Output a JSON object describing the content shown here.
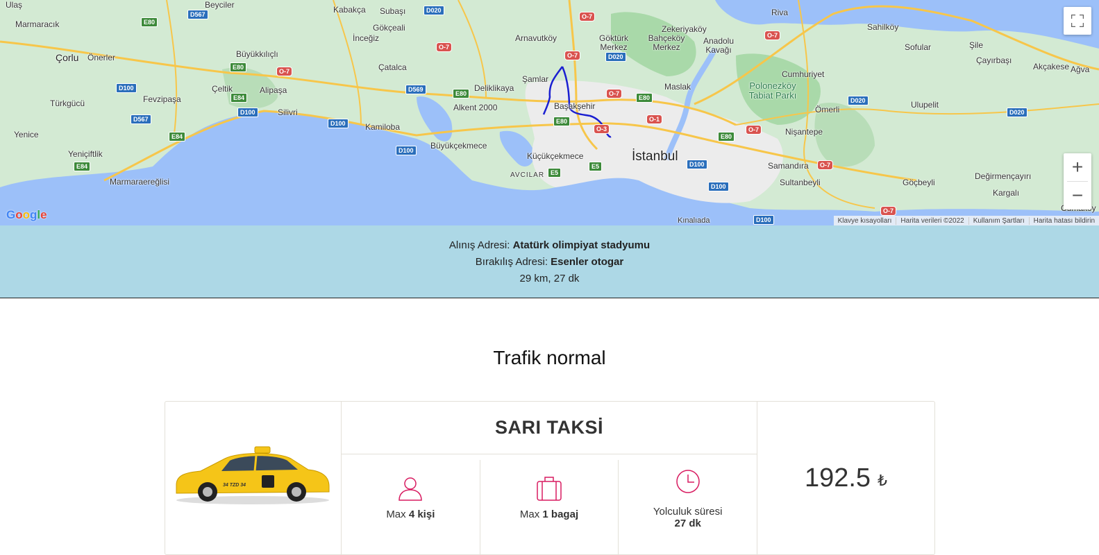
{
  "map": {
    "places": [
      {
        "name": "Ulaş",
        "cls": ""
      },
      {
        "name": "Beyciler",
        "cls": ""
      },
      {
        "name": "Kabakça",
        "cls": ""
      },
      {
        "name": "Subaşı",
        "cls": ""
      },
      {
        "name": "Marmaracık",
        "cls": ""
      },
      {
        "name": "Gökçeali",
        "cls": ""
      },
      {
        "name": "İnceğiz",
        "cls": ""
      },
      {
        "name": "Çorlu",
        "cls": "med"
      },
      {
        "name": "Önerler",
        "cls": ""
      },
      {
        "name": "Büyükkılıçlı",
        "cls": ""
      },
      {
        "name": "Arnavutköy",
        "cls": ""
      },
      {
        "name": "Göktürk Merkez",
        "cls": ""
      },
      {
        "name": "Zekeriyaköy",
        "cls": ""
      },
      {
        "name": "Bahçeköy Merkez",
        "cls": ""
      },
      {
        "name": "Anadolu Kavağı",
        "cls": ""
      },
      {
        "name": "Riva",
        "cls": ""
      },
      {
        "name": "Sahilköy",
        "cls": ""
      },
      {
        "name": "Sofular",
        "cls": ""
      },
      {
        "name": "Şile",
        "cls": ""
      },
      {
        "name": "Çayırbaşı",
        "cls": ""
      },
      {
        "name": "Akçakese",
        "cls": ""
      },
      {
        "name": "Ağva",
        "cls": ""
      },
      {
        "name": "Çatalca",
        "cls": ""
      },
      {
        "name": "Şamlar",
        "cls": ""
      },
      {
        "name": "Alipaşa",
        "cls": ""
      },
      {
        "name": "Çeltik",
        "cls": ""
      },
      {
        "name": "Deliklikaya",
        "cls": ""
      },
      {
        "name": "Maslak",
        "cls": ""
      },
      {
        "name": "Cumhuriyet",
        "cls": ""
      },
      {
        "name": "Polonezköy Tabiat Parkı",
        "cls": "park"
      },
      {
        "name": "Türkgücü",
        "cls": ""
      },
      {
        "name": "Fevzipaşa",
        "cls": ""
      },
      {
        "name": "Silivri",
        "cls": ""
      },
      {
        "name": "Alkent 2000",
        "cls": ""
      },
      {
        "name": "Başakşehir",
        "cls": ""
      },
      {
        "name": "Ömerli",
        "cls": ""
      },
      {
        "name": "Ulupelit",
        "cls": ""
      },
      {
        "name": "Yenice",
        "cls": ""
      },
      {
        "name": "Kamiloba",
        "cls": ""
      },
      {
        "name": "Nişantepe",
        "cls": ""
      },
      {
        "name": "Büyükçekmece",
        "cls": ""
      },
      {
        "name": "Yeniçiftlik",
        "cls": ""
      },
      {
        "name": "Küçükçekmece",
        "cls": ""
      },
      {
        "name": "İstanbul",
        "cls": "big"
      },
      {
        "name": "Samandıra",
        "cls": ""
      },
      {
        "name": "AVCILAR",
        "cls": ""
      },
      {
        "name": "Sultanbeyli",
        "cls": ""
      },
      {
        "name": "Göçbeyli",
        "cls": ""
      },
      {
        "name": "Değirmençayırı",
        "cls": ""
      },
      {
        "name": "Marmaraereğlisi",
        "cls": ""
      },
      {
        "name": "Kargalı",
        "cls": ""
      },
      {
        "name": "Kınalıada",
        "cls": ""
      },
      {
        "name": "Cumaköy",
        "cls": ""
      }
    ],
    "shields": [
      {
        "t": "D567",
        "c": "blue"
      },
      {
        "t": "D020",
        "c": "blue"
      },
      {
        "t": "E80",
        "c": "green"
      },
      {
        "t": "O-7",
        "c": "red"
      },
      {
        "t": "O-7",
        "c": "red"
      },
      {
        "t": "D020",
        "c": "blue"
      },
      {
        "t": "O-7",
        "c": "red"
      },
      {
        "t": "E80",
        "c": "green"
      },
      {
        "t": "O-7",
        "c": "red"
      },
      {
        "t": "D100",
        "c": "blue"
      },
      {
        "t": "D569",
        "c": "blue"
      },
      {
        "t": "E80",
        "c": "green"
      },
      {
        "t": "O-7",
        "c": "red"
      },
      {
        "t": "E84",
        "c": "green"
      },
      {
        "t": "E80",
        "c": "green"
      },
      {
        "t": "D100",
        "c": "blue"
      },
      {
        "t": "D567",
        "c": "blue"
      },
      {
        "t": "O-1",
        "c": "red"
      },
      {
        "t": "E80",
        "c": "green"
      },
      {
        "t": "O-3",
        "c": "red"
      },
      {
        "t": "D100",
        "c": "blue"
      },
      {
        "t": "D020",
        "c": "blue"
      },
      {
        "t": "O-7",
        "c": "red"
      },
      {
        "t": "E84",
        "c": "green"
      },
      {
        "t": "E80",
        "c": "green"
      },
      {
        "t": "O-7",
        "c": "red"
      },
      {
        "t": "D100",
        "c": "blue"
      },
      {
        "t": "D020",
        "c": "blue"
      },
      {
        "t": "E84",
        "c": "green"
      },
      {
        "t": "E5",
        "c": "green"
      },
      {
        "t": "E5",
        "c": "green"
      },
      {
        "t": "D100",
        "c": "blue"
      },
      {
        "t": "O-7",
        "c": "red"
      },
      {
        "t": "D100",
        "c": "blue"
      },
      {
        "t": "D100",
        "c": "blue"
      },
      {
        "t": "O-7",
        "c": "red"
      }
    ],
    "google": "Google",
    "attribution": [
      "Klavye kısayolları",
      "Harita verileri ©2022",
      "Kullanım Şartları",
      "Harita hatası bildirin"
    ],
    "fullscreen_icon": "fullscreen-icon",
    "zoom_in": "+",
    "zoom_out": "−"
  },
  "address": {
    "pickup_label": "Alınış Adresi:",
    "pickup_value": "Atatürk olimpiyat stadyumu",
    "dropoff_label": "Bırakılış Adresi:",
    "dropoff_value": "Esenler otogar",
    "summary": "29 km, 27 dk"
  },
  "traffic": "Trafik normal",
  "vehicle": {
    "title": "SARI TAKSİ",
    "plate": "34 TZD 34",
    "capacity_prefix": "Max",
    "capacity_value": "4 kişi",
    "luggage_prefix": "Max",
    "luggage_value": "1 bagaj",
    "duration_label": "Yolculuk süresi",
    "duration_value": "27 dk",
    "price": "192.5",
    "currency": "₺"
  }
}
